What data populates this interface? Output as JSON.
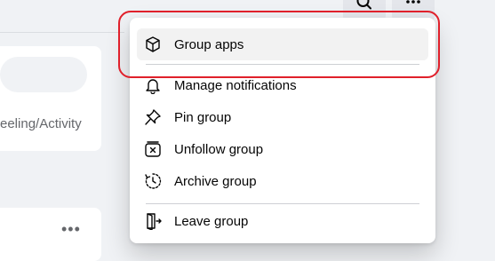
{
  "menu": {
    "items": [
      {
        "label": "Group apps",
        "icon": "cube-icon"
      },
      {
        "label": "Manage notifications",
        "icon": "bell-icon"
      },
      {
        "label": "Pin group",
        "icon": "pin-icon"
      },
      {
        "label": "Unfollow group",
        "icon": "unfollow-icon"
      },
      {
        "label": "Archive group",
        "icon": "archive-icon"
      },
      {
        "label": "Leave group",
        "icon": "leave-icon"
      }
    ]
  },
  "background": {
    "activity_text": "eeling/Activity",
    "more_dots": "•••"
  },
  "colors": {
    "highlight_ring": "#e0202b",
    "menu_background": "#ffffff",
    "hover_background": "#f2f2f2"
  }
}
